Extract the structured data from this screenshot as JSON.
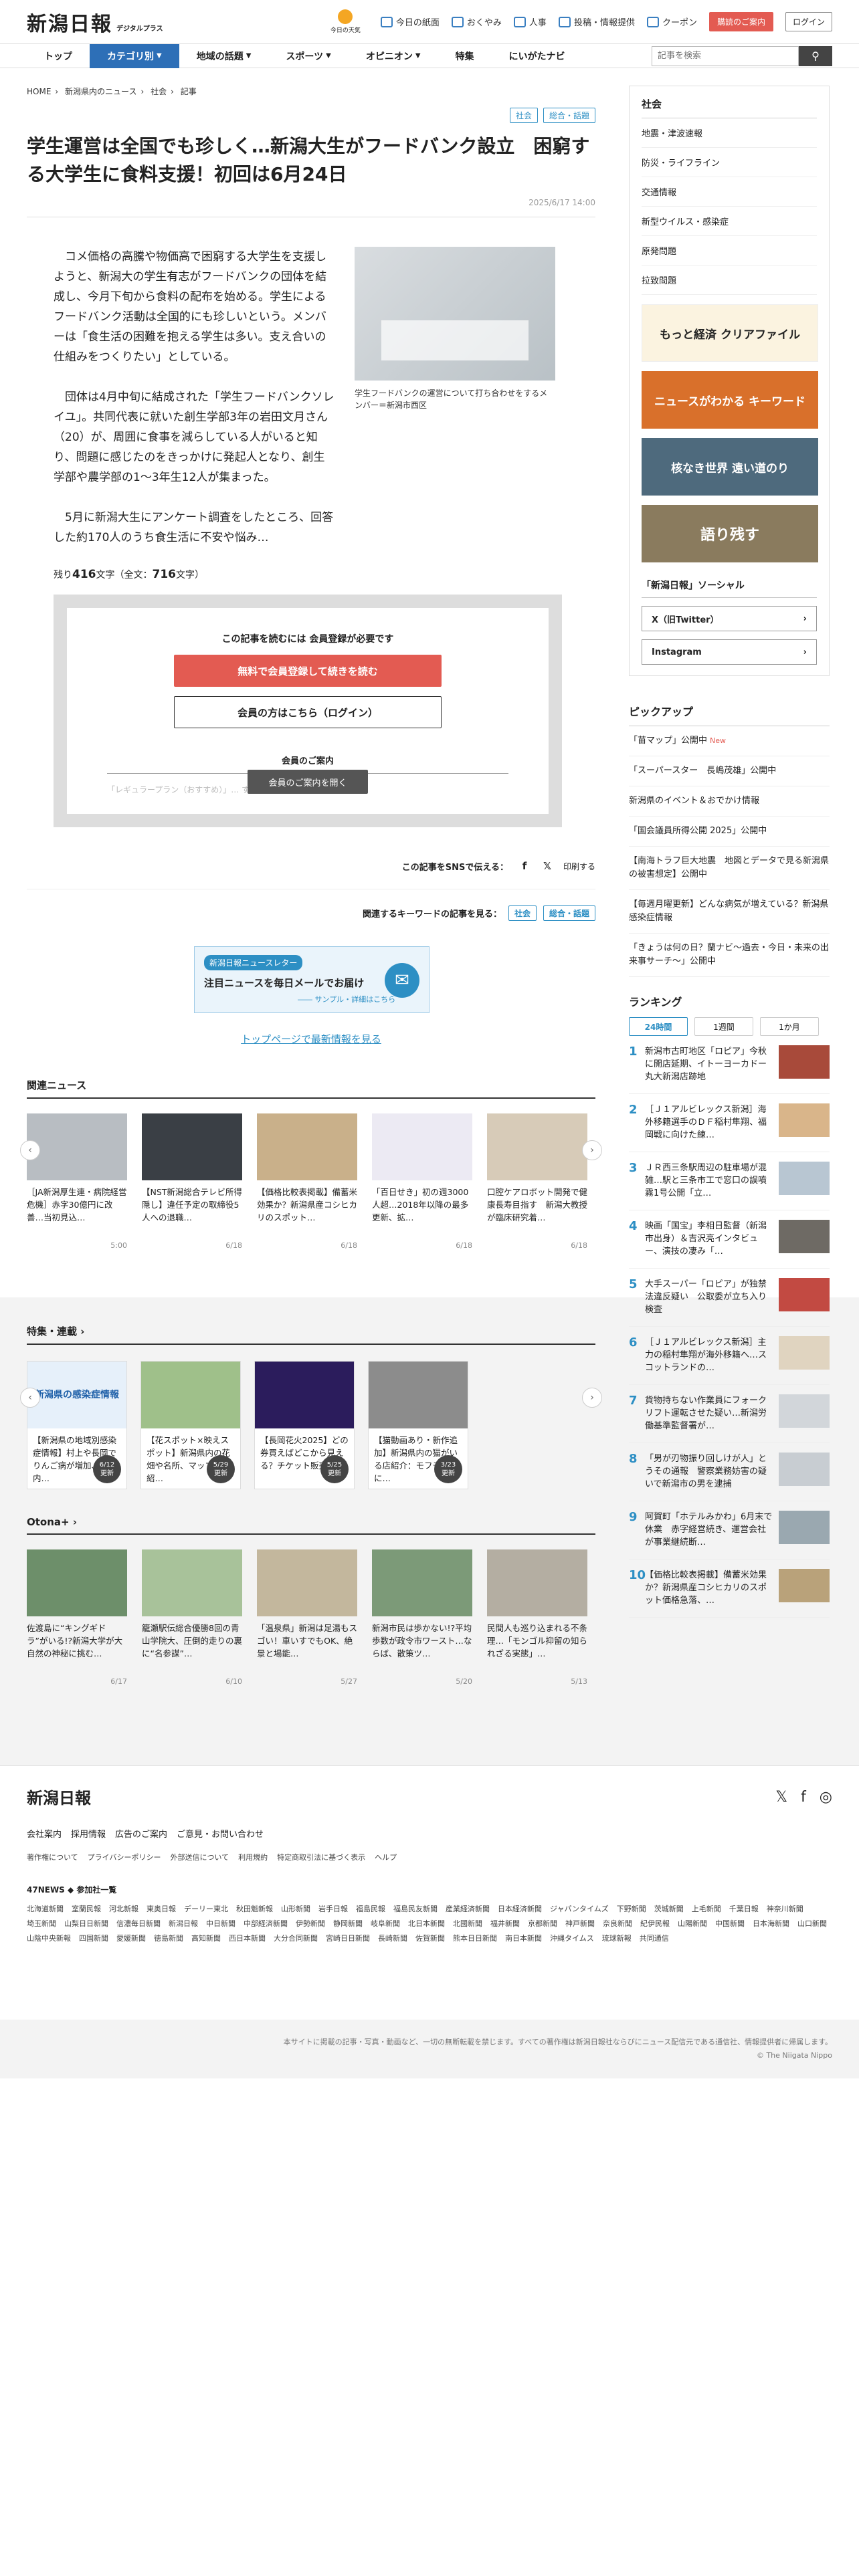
{
  "header": {
    "logo": "新潟日報",
    "logo_sub": "デジタルプラス",
    "weather_label": "今日の天気",
    "links": [
      "今日の紙面",
      "おくやみ",
      "人事",
      "投稿・情報提供",
      "クーポン"
    ],
    "register": "購読のご案内",
    "login": "ログイン"
  },
  "nav": {
    "items": [
      "トップ",
      "カテゴリ別",
      "地域の話題",
      "スポーツ",
      "オピニオン",
      "特集",
      "にいがたナビ"
    ],
    "search_placeholder": "記事を検索"
  },
  "breadcrumb": [
    "HOME",
    "新潟県内のニュース",
    "社会",
    "記事"
  ],
  "article": {
    "tags": [
      "社会",
      "総合・話題"
    ],
    "title": "学生運営は全国でも珍しく…新潟大生がフードバンク設立　困窮する大学生に食料支援！初回は6月24日",
    "date": "2025/6/17 14:00",
    "paragraphs": [
      "コメ価格の高騰や物価高で困窮する大学生を支援しようと、新潟大の学生有志がフードバンクの団体を結成し、今月下旬から食料の配布を始める。学生によるフードバンク活動は全国的にも珍しいという。メンバーは「食生活の困難を抱える学生は多い。支え合いの仕組みをつくりたい」としている。",
      "団体は4月中旬に結成された「学生フードバンクソレイユ」。共同代表に就いた創生学部3年の岩田文月さん（20）が、周囲に食事を減らしている人がいると知り、問題に感じたのをきっかけに発起人となり、創生学部や農学部の1～3年生12人が集まった。",
      "5月に新潟大生にアンケート調査をしたところ、回答した約170人のうち食生活に不安や悩み…"
    ],
    "photo_caption": "学生フードバンクの運営について打ち合わせをするメンバー＝新潟市西区",
    "remain_label": "残り",
    "remain_count": "416",
    "remain_mid": "文字（全文：",
    "total_count": "716",
    "remain_end": "文字）"
  },
  "paywall": {
    "lead": "この記事を読むには 会員登録が必要です",
    "register_btn": "無料で会員登録して続きを読む",
    "login_btn": "会員の方はこちら（ログイン）",
    "guide": "会員のご案内",
    "faded": "「レギュラープラン（おすすめ）」… すべての記事・紙面ビューアー…",
    "open_btn": "会員のご案内を開く"
  },
  "share": {
    "label": "この記事をSNSで伝える：",
    "print": "印刷する",
    "kw_label": "関連するキーワードの記事を見る：",
    "kw_tags": [
      "社会",
      "総合・話題"
    ]
  },
  "newsletter": {
    "badge": "新潟日報ニュースレター",
    "title": "注目ニュースを毎日メールでお届け",
    "sub": "―― サンプル・詳細はこちら"
  },
  "toplink": "トップページで最新情報を見る",
  "related": {
    "heading": "関連ニュース",
    "cards": [
      {
        "cap": "［JA新潟厚生連・病院経営危機］赤字30億円に改善…当初見込…",
        "date": "5:00"
      },
      {
        "cap": "【NST新潟総合テレビ所得隠し】違任予定の取締役5人への退職…",
        "date": "6/18"
      },
      {
        "cap": "【価格比較表掲載】備蓄米効果か？新潟県産コシヒカリのスポット…",
        "date": "6/18"
      },
      {
        "cap": "「百日せき」初の週3000人超…2018年以降の最多更新、拡…",
        "date": "6/18"
      },
      {
        "cap": "口腔ケアロボット開発で健康長寿目指す　新潟大教授が臨床研究着…",
        "date": "6/18"
      }
    ]
  },
  "features": {
    "heading": "特集・連載",
    "cards": [
      {
        "cap": "【新潟県の地域別感染症情報】村上や長岡でりんご病が増加、県内…",
        "upd": "6/12"
      },
      {
        "cap": "【花スポット×映えスポット】新潟県内の花畑や名所、マップで紹…",
        "upd": "5/29"
      },
      {
        "cap": "【長岡花火2025】どの券買えばどこから見える？チケット販売…",
        "upd": "5/25"
      },
      {
        "cap": "【猫動画あり・新作追加】新潟県内の猫がいる店紹介：モフモフに…",
        "upd": "3/23"
      }
    ],
    "upd_label": "更新",
    "thumb1_label": "新潟県の感染症情報"
  },
  "otona": {
    "heading": "Otona+",
    "cards": [
      {
        "cap": "佐渡島に“キングギドラ”がいる!?新潟大学が大自然の神秘に挑む…",
        "date": "6/17"
      },
      {
        "cap": "籠瀬駅伝総合優勝8回の青山学院大、圧倒的走りの裏に“名参謀”…",
        "date": "6/10"
      },
      {
        "cap": "「温泉県」新潟は足湯もスゴい！車いすでもOK、絶景と場能…",
        "date": "5/27"
      },
      {
        "cap": "新潟市民は歩かない!?平均歩数が政令市ワースト…ならば、散策ツ…",
        "date": "5/20"
      },
      {
        "cap": "民間人も巡り込まれる不条理…「モンゴル抑留の知られざる実態」…",
        "date": "5/13"
      }
    ]
  },
  "sidebar": {
    "heading": "社会",
    "items": [
      "地震・津波速報",
      "防災・ライフライン",
      "交通情報",
      "新型ウイルス・感染症",
      "原発問題",
      "拉致問題"
    ],
    "banners": [
      "もっと経済 クリアファイル",
      "ニュースがわかる キーワード",
      "核なき世界 遠い道のり",
      "語り残す"
    ],
    "social_heading": "「新潟日報」ソーシャル",
    "social": [
      "X（旧Twitter）",
      "Instagram"
    ]
  },
  "pickup": {
    "heading": "ピックアップ",
    "new_label": "New",
    "items": [
      "「苗マップ」公開中",
      "「スーパースター　長嶋茂雄」公開中",
      "新潟県のイベント＆おでかけ情報",
      "「国会議員所得公開 2025」公開中",
      "【南海トラフ巨大地震　地図とデータで見る新潟県の被害想定】公開中",
      "【毎週月曜更新】どんな病気が増えている？新潟県感染症情報",
      "「きょうは何の日？蘭ナビ～過去・今日・未来の出来事サーチ～」公開中"
    ]
  },
  "ranking": {
    "heading": "ランキング",
    "tabs": [
      "24時間",
      "1週間",
      "1か月"
    ],
    "items": [
      "新潟市古町地区「ロピア」今秋に開店延期、イトーヨーカドー丸大新潟店跡地",
      "［Ｊ１アルビレックス新潟］海外移籍選手のＤＦ稲村隼翔、福岡戦に向けた練…",
      "ＪＲ西三条駅周辺の駐車場が混雑…駅と三条市工で窓口の誤噴霧1号公開「立…",
      "映画「国宝」李相日監督（新潟市出身）＆吉沢亮インタビュー、演技の凄み「…",
      "大手スーパー「ロピア」が独禁法違反疑い　公取委が立ち入り検査",
      "［Ｊ１アルビレックス新潟］主力の稲村隼翔が海外移籍へ…スコットランドの…",
      "貨物持ちない作業員にフォークリフト運転させた疑い…新潟労働基準監督署が…",
      "「男が刃物振り回しけが人」とうその通報　警察業務妨害の疑いで新潟市の男を逮捕",
      "阿賀町「ホテルみかわ」6月末で休業　赤字経営続き、運営会社が事業継続断…",
      "【価格比較表掲載】備蓄米効果か？新潟県産コシヒカリのスポット価格急落、…"
    ]
  },
  "footer": {
    "logo": "新潟日報",
    "links": [
      "会社案内",
      "採用情報",
      "広告のご案内",
      "ご意見・お問い合わせ"
    ],
    "links2": [
      "著作権について",
      "プライバシーポリシー",
      "外部送信について",
      "利用規約",
      "特定商取引法に基づく表示",
      "ヘルプ"
    ],
    "news47": "47NEWS ◆ 参加社一覧",
    "papers": [
      "北海道新聞",
      "室蘭民報",
      "河北新報",
      "東奥日報",
      "デーリー東北",
      "秋田魁新報",
      "山形新聞",
      "岩手日報",
      "福島民報",
      "福島民友新聞",
      "産業経済新聞",
      "日本経済新聞",
      "ジャパンタイムズ",
      "下野新聞",
      "茨城新聞",
      "上毛新聞",
      "千葉日報",
      "神奈川新聞",
      "埼玉新聞",
      "山梨日日新聞",
      "信濃毎日新聞",
      "新潟日報",
      "中日新聞",
      "中部経済新聞",
      "伊勢新聞",
      "静岡新聞",
      "岐阜新聞",
      "北日本新聞",
      "北國新聞",
      "福井新聞",
      "京都新聞",
      "神戸新聞",
      "奈良新聞",
      "紀伊民報",
      "山陽新聞",
      "中国新聞",
      "日本海新聞",
      "山口新聞",
      "山陰中央新報",
      "四国新聞",
      "愛媛新聞",
      "徳島新聞",
      "高知新聞",
      "西日本新聞",
      "大分合同新聞",
      "宮崎日日新聞",
      "長崎新聞",
      "佐賀新聞",
      "熊本日日新聞",
      "南日本新聞",
      "沖縄タイムス",
      "琉球新報",
      "共同通信"
    ],
    "notice": "本サイトに掲載の記事・写真・動画など、一切の無断転載を禁じます。すべての著作権は新潟日報社ならびにニュース配信元である通信社、情報提供者に帰属します。",
    "copyright": "© The Niigata Nippo"
  },
  "colors": {
    "accent": "#2d6fb7",
    "link": "#2d8fc4",
    "cta": "#e35b52"
  }
}
